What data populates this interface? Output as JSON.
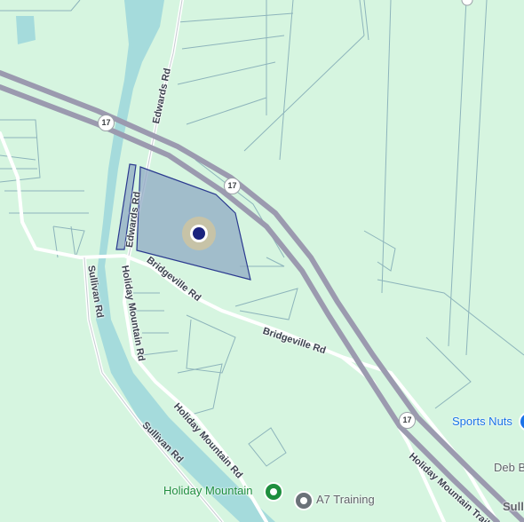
{
  "roads": {
    "edwards_rd_north": "Edwards Rd",
    "edwards_rd_south": "Edwards Rd",
    "bridgeville_rd_west": "Bridgeville Rd",
    "bridgeville_rd_east": "Bridgeville Rd",
    "holiday_mountain_rd_north": "Holiday Mountain Rd",
    "holiday_mountain_rd_south": "Holiday Mountain Rd",
    "sullivan_rd_north": "Sullivan Rd",
    "sullivan_rd_south": "Sullivan Rd",
    "holiday_mountain_trail": "Holiday Mountain Trail"
  },
  "route_shields": [
    "17",
    "17",
    "17"
  ],
  "pois": {
    "sports_nuts": "Sports Nuts",
    "deb": "Deb B",
    "holiday_mountain": "Holiday Mountain",
    "a7_training": "A7 Training",
    "sull": "Sull"
  },
  "colors": {
    "land": "#d6f5e0",
    "water": "#a5dbdc",
    "highway": "#9b9aaf",
    "road": "#ffffff",
    "parcel_line": "#8db4bb",
    "selection_fill": "#8fa9c4",
    "selection_stroke": "#2b3a8f",
    "location_dot": "#1a237e",
    "poi_green": "#1e8e3e",
    "poi_blue": "#1a73e8",
    "poi_gray": "#6b7279"
  },
  "icons": {
    "location_marker": "location-dot-icon",
    "holiday_mountain": "park-pin-icon",
    "a7_training": "place-pin-icon",
    "sports_nuts": "shopping-pin-icon"
  }
}
